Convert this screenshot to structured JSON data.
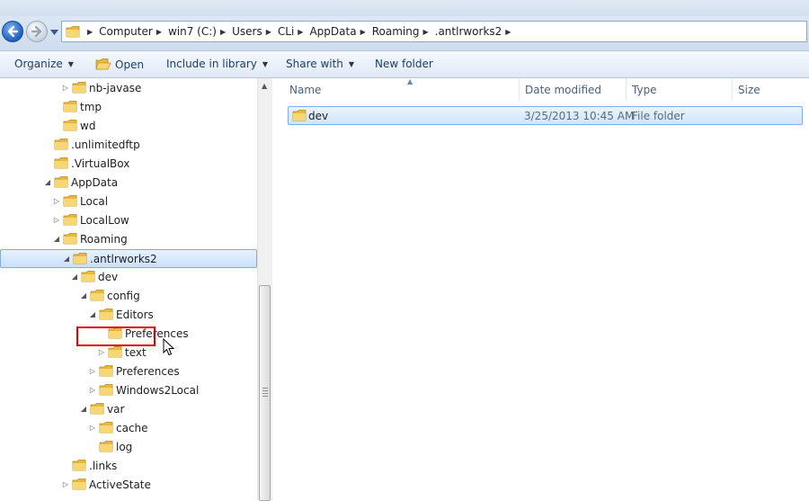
{
  "address": {
    "crumbs": [
      "Computer",
      "win7 (C:)",
      "Users",
      "CLi",
      "AppData",
      "Roaming",
      ".antlrworks2"
    ]
  },
  "toolbar": {
    "organize": "Organize",
    "open": "Open",
    "include_in_library": "Include in library",
    "share_with": "Share with",
    "new_folder": "New folder"
  },
  "tree": [
    {
      "label": "nb-javase",
      "expander": "collapsed"
    },
    {
      "label": "tmp",
      "expander": "none"
    },
    {
      "label": "wd",
      "expander": "none"
    },
    {
      "label": ".unlimitedftp",
      "expander": "none"
    },
    {
      "label": ".VirtualBox",
      "expander": "none"
    },
    {
      "label": "AppData",
      "expander": "expanded"
    },
    {
      "label": "Local",
      "expander": "collapsed"
    },
    {
      "label": "LocalLow",
      "expander": "collapsed"
    },
    {
      "label": "Roaming",
      "expander": "expanded"
    },
    {
      "label": ".antlrworks2",
      "expander": "expanded",
      "selected": true
    },
    {
      "label": "dev",
      "expander": "expanded"
    },
    {
      "label": "config",
      "expander": "expanded"
    },
    {
      "label": "Editors",
      "expander": "expanded"
    },
    {
      "label": "Preferences",
      "expander": "none"
    },
    {
      "label": "text",
      "expander": "collapsed"
    },
    {
      "label": "Preferences",
      "expander": "collapsed"
    },
    {
      "label": "Windows2Local",
      "expander": "collapsed"
    },
    {
      "label": "var",
      "expander": "expanded"
    },
    {
      "label": "cache",
      "expander": "collapsed"
    },
    {
      "label": "log",
      "expander": "none"
    },
    {
      "label": ".links",
      "expander": "none"
    },
    {
      "label": "ActiveState",
      "expander": "collapsed"
    }
  ],
  "columns": {
    "name": "Name",
    "date_modified": "Date modified",
    "type": "Type",
    "size": "Size"
  },
  "files": [
    {
      "name": "dev",
      "date_modified": "3/25/2013 10:45 AM",
      "type": "File folder",
      "size": ""
    }
  ],
  "colors": {
    "highlight_border": "#e00000",
    "selection_fill": "#cfe4fb",
    "folder_yellow": "#f4cc5c"
  }
}
